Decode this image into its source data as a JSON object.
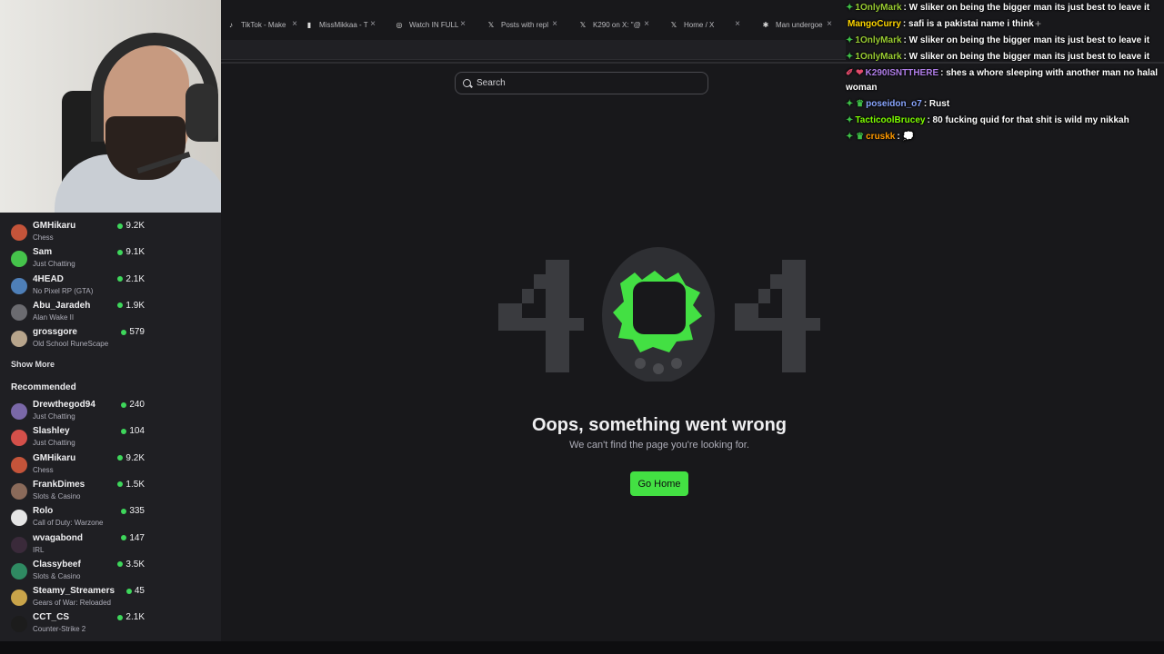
{
  "browser": {
    "tabs": [
      {
        "label": "TikTok - Make",
        "icon": "tiktok-icon",
        "icon_glyph": "♪"
      },
      {
        "label": "MissMikkaa - T",
        "icon": "twitch-icon",
        "icon_glyph": "▮"
      },
      {
        "label": "Watch IN FULL",
        "icon": "globe-icon",
        "icon_glyph": "◎"
      },
      {
        "label": "Posts with repl",
        "icon": "x-icon",
        "icon_glyph": "𝕏"
      },
      {
        "label": "K290 on X: \"@",
        "icon": "x-icon",
        "icon_glyph": "𝕏"
      },
      {
        "label": "Home / X",
        "icon": "x-icon",
        "icon_glyph": "𝕏"
      },
      {
        "label": "Man undergoe",
        "icon": "slack-icon",
        "icon_glyph": "✱"
      }
    ],
    "close_glyph": "×",
    "new_tab_glyph": "+"
  },
  "search": {
    "placeholder": "Search"
  },
  "sidebar": {
    "followed": [
      {
        "name": "GMHikaru",
        "category": "Chess",
        "viewers": "9.2K",
        "avatar_color": "#c4543a"
      },
      {
        "name": "Sam",
        "category": "Just Chatting",
        "viewers": "9.1K",
        "avatar_color": "#45c34b"
      },
      {
        "name": "4HEAD",
        "category": "No Pixel RP (GTA)",
        "viewers": "2.1K",
        "avatar_color": "#4e7fb8"
      },
      {
        "name": "Abu_Jaradeh",
        "category": "Alan Wake II",
        "viewers": "1.9K",
        "avatar_color": "#6b6b70"
      },
      {
        "name": "grossgore",
        "category": "Old School RuneScape",
        "viewers": "579",
        "avatar_color": "#b8a58c"
      }
    ],
    "show_more": "Show More",
    "recommended_title": "Recommended",
    "recommended": [
      {
        "name": "Drewthegod94",
        "category": "Just Chatting",
        "viewers": "240",
        "avatar_color": "#7a68a8"
      },
      {
        "name": "Slashley",
        "category": "Just Chatting",
        "viewers": "104",
        "avatar_color": "#d4504a"
      },
      {
        "name": "GMHikaru",
        "category": "Chess",
        "viewers": "9.2K",
        "avatar_color": "#c4543a"
      },
      {
        "name": "FrankDimes",
        "category": "Slots & Casino",
        "viewers": "1.5K",
        "avatar_color": "#8a6a5a"
      },
      {
        "name": "Rolo",
        "category": "Call of Duty: Warzone",
        "viewers": "335",
        "avatar_color": "#e5e5e5"
      },
      {
        "name": "wvagabond",
        "category": "IRL",
        "viewers": "147",
        "avatar_color": "#3a2a3a"
      },
      {
        "name": "Classybeef",
        "category": "Slots & Casino",
        "viewers": "3.5K",
        "avatar_color": "#2f8a62"
      },
      {
        "name": "Steamy_Streamers",
        "category": "Gears of War: Reloaded",
        "viewers": "45",
        "avatar_color": "#c9a44a"
      },
      {
        "name": "CCT_CS",
        "category": "Counter-Strike 2",
        "viewers": "2.1K",
        "avatar_color": "#1c1c1c"
      }
    ]
  },
  "error": {
    "code_left": "4",
    "code_right": "4",
    "title": "Oops, something went wrong",
    "subtitle": "We can't find the page you're looking for.",
    "button": "Go Home"
  },
  "chat": {
    "messages": [
      {
        "badge": "✦",
        "badge_class": "badge",
        "user": "1OnlyMark",
        "user_color": "#9acd32",
        "text": ": W sliker on being the bigger man its just best to leave it"
      },
      {
        "badge": "",
        "badge_class": "badge",
        "user": "MangoCurry",
        "user_color": "#ffd700",
        "text": ": safi is a pakistai name i think"
      },
      {
        "badge": "✦",
        "badge_class": "badge",
        "user": "1OnlyMark",
        "user_color": "#9acd32",
        "text": ": W sliker on being the bigger man its just best to leave it"
      },
      {
        "badge": "✦",
        "badge_class": "badge",
        "user": "1OnlyMark",
        "user_color": "#9acd32",
        "text": ": W sliker on being the bigger man its just best to leave it"
      },
      {
        "badge": "✐ ❤",
        "badge_class": "heart",
        "user": "K290ISNTTHERE",
        "user_color": "#b07ee8",
        "text": ": shes a whore sleeping with another man no halal woman"
      },
      {
        "badge": "✦ ♛",
        "badge_class": "badge",
        "user": "poseidon_o7",
        "user_color": "#8aa6ff",
        "text": ": Rust"
      },
      {
        "badge": "✦",
        "badge_class": "badge",
        "user": "TacticoolBrucey",
        "user_color": "#7fff00",
        "text": ": 80 fucking quid for that shit is wild my nikkah"
      },
      {
        "badge": "✦ ♛",
        "badge_class": "badge",
        "user": "cruskk",
        "user_color": "#ff9900",
        "text": ": 💭"
      }
    ]
  },
  "colors": {
    "background": "#18181b",
    "sidebar": "#1f1f23",
    "accent": "#43e043",
    "live_dot": "#3ed65b"
  }
}
